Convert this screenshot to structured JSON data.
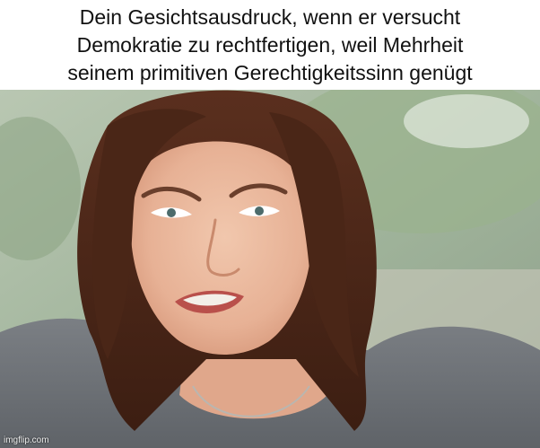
{
  "caption": {
    "line1": "Dein Gesichtsausdruck, wenn er versucht",
    "line2": "Demokratie zu rechtfertigen, weil Mehrheit",
    "line3": "seinem primitiven Gerechtigkeitssinn genügt"
  },
  "watermark": "imgflip.com",
  "colors": {
    "background": "#ffffff",
    "text": "#111111"
  },
  "photo": {
    "subject": "young woman with shoulder-length dark hair grimacing in disgust"
  }
}
